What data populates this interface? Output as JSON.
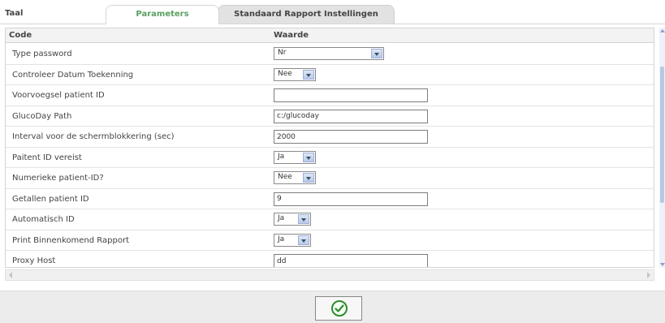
{
  "tabs": [
    {
      "label": "Taal"
    },
    {
      "label": "Parameters"
    },
    {
      "label": "Standaard Rapport Instellingen"
    }
  ],
  "table": {
    "headers": {
      "code": "Code",
      "value": "Waarde"
    },
    "rows": [
      {
        "label": "Type password",
        "type": "select",
        "value": "Nr"
      },
      {
        "label": "Controleer Datum Toekenning",
        "type": "select",
        "value": "Nee"
      },
      {
        "label": "Voorvoegsel patient ID",
        "type": "text",
        "value": ""
      },
      {
        "label": "GlucoDay Path",
        "type": "text",
        "value": "c:/glucoday"
      },
      {
        "label": "Interval voor de schermblokkering (sec)",
        "type": "text",
        "value": "2000"
      },
      {
        "label": "Paitent ID vereist",
        "type": "select",
        "value": "Ja"
      },
      {
        "label": "Numerieke patient-ID?",
        "type": "select",
        "value": "Nee"
      },
      {
        "label": "Getallen patient ID",
        "type": "text",
        "value": "9"
      },
      {
        "label": "Automatisch ID",
        "type": "select",
        "value": "Ja"
      },
      {
        "label": "Print Binnenkomend Rapport",
        "type": "select",
        "value": "Ja"
      },
      {
        "label": "Proxy Host",
        "type": "text",
        "value": "dd"
      }
    ]
  },
  "footer": {
    "ok_icon": "checkmark-circle-icon"
  },
  "colors": {
    "active_tab_text": "#5aa060",
    "ok_icon": "#2e8a2e",
    "scrollbar": "#b7c8e6"
  }
}
